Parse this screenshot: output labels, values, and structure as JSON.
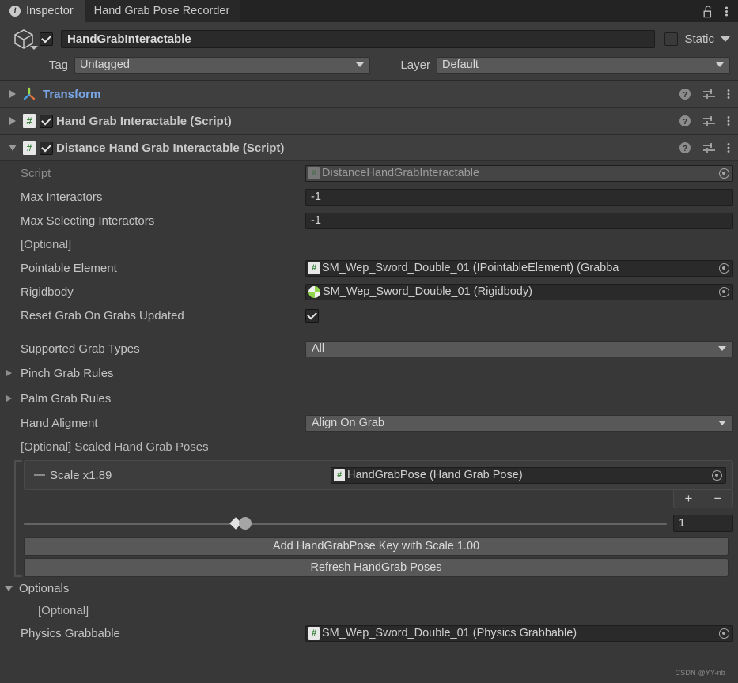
{
  "window": {
    "tabs": [
      {
        "label": "Inspector",
        "icon": "info-icon",
        "active": true
      },
      {
        "label": "Hand Grab Pose Recorder",
        "active": false
      }
    ],
    "lock_icon": "lock-open-icon",
    "menu_icon": "kebab-menu-icon"
  },
  "gameobject": {
    "icon": "gameobject-cube-icon",
    "enabled": true,
    "name": "HandGrabInteractable",
    "static_label": "Static",
    "static_checked": false,
    "tag_label": "Tag",
    "tag_value": "Untagged",
    "layer_label": "Layer",
    "layer_value": "Default"
  },
  "components": [
    {
      "title": "Transform",
      "icon": "transform-icon",
      "expanded": false,
      "has_enable_toggle": false,
      "enabled": false,
      "is_transform": true
    },
    {
      "title": "Hand Grab Interactable (Script)",
      "icon": "script-icon",
      "expanded": false,
      "has_enable_toggle": true,
      "enabled": true,
      "is_transform": false
    },
    {
      "title": "Distance Hand Grab Interactable (Script)",
      "icon": "script-icon",
      "expanded": true,
      "has_enable_toggle": true,
      "enabled": true,
      "is_transform": false
    }
  ],
  "header_icons": {
    "help": "help-icon",
    "preset": "preset-settings-icon",
    "menu": "kebab-menu-icon"
  },
  "properties": {
    "script": {
      "label": "Script",
      "value": "DistanceHandGrabInteractable",
      "icon": "script-asset-icon"
    },
    "max_interactors": {
      "label": "Max Interactors",
      "value": "-1"
    },
    "max_selecting_interactors": {
      "label": "Max Selecting Interactors",
      "value": "-1"
    },
    "optional_note_1": "[Optional]",
    "pointable_element": {
      "label": "Pointable Element",
      "value": "SM_Wep_Sword_Double_01 (IPointableElement) (Grabba",
      "icon": "script-asset-icon"
    },
    "rigidbody": {
      "label": "Rigidbody",
      "value": "SM_Wep_Sword_Double_01 (Rigidbody)",
      "icon": "rigidbody-icon"
    },
    "reset_grab": {
      "label": "Reset Grab On Grabs Updated",
      "checked": true
    },
    "supported_grab_types": {
      "label": "Supported Grab Types",
      "value": "All"
    },
    "pinch_grab_rules": {
      "label": "Pinch Grab Rules",
      "expanded": false
    },
    "palm_grab_rules": {
      "label": "Palm Grab Rules",
      "expanded": false
    },
    "hand_alignment": {
      "label": "Hand Aligment",
      "value": "Align On Grab"
    },
    "scaled_poses_header": "[Optional] Scaled Hand Grab Poses"
  },
  "pose_list": {
    "items": [
      {
        "label": "Scale x1.89",
        "object_value": "HandGrabPose (Hand Grab Pose)",
        "icon": "script-asset-icon"
      }
    ],
    "add_label": "+",
    "remove_label": "−",
    "slider_value": "1",
    "slider_percent": 33
  },
  "buttons": {
    "add_key": "Add HandGrabPose Key with Scale 1.00",
    "refresh": "Refresh HandGrab Poses"
  },
  "optionals": {
    "header": "Optionals",
    "expanded": true,
    "optional_note": "[Optional]",
    "physics_grabbable": {
      "label": "Physics Grabbable",
      "value": "SM_Wep_Sword_Double_01 (Physics Grabbable)",
      "icon": "script-asset-icon"
    }
  },
  "watermark": "CSDN @YY-nb",
  "colors": {
    "background": "#383838",
    "panel": "#3c3c3c",
    "tabbar": "#232323",
    "component_header": "#3f3f3f",
    "field_dark": "#2a2a2a",
    "field_button": "#585858",
    "transform_title": "#7aa7e8",
    "script_icon_green": "#2f7d32",
    "rigidbody_green": "#8fd44a"
  }
}
